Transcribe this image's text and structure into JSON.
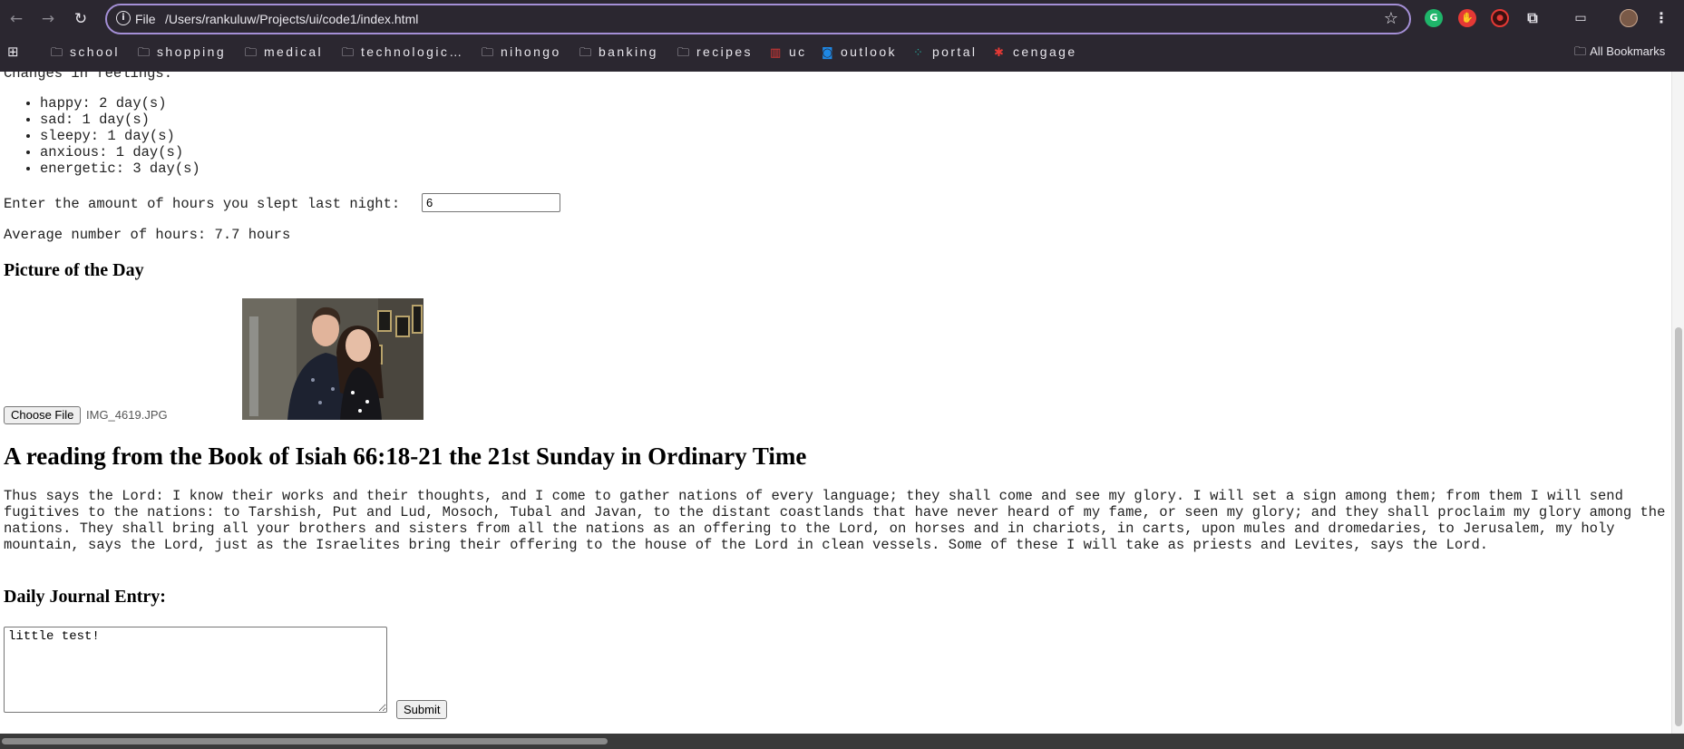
{
  "browser": {
    "scheme_label": "File",
    "url": "/Users/rankuluw/Projects/ui/code1/index.html",
    "bookmarks": [
      {
        "label": "school",
        "icon": "folder-icon"
      },
      {
        "label": "shopping",
        "icon": "folder-icon"
      },
      {
        "label": "medical",
        "icon": "folder-icon"
      },
      {
        "label": "technologic…",
        "icon": "folder-icon"
      },
      {
        "label": "nihongo",
        "icon": "folder-icon"
      },
      {
        "label": "banking",
        "icon": "folder-icon"
      },
      {
        "label": "recipes",
        "icon": "folder-icon"
      },
      {
        "label": "uc",
        "icon": "uc-logo-icon"
      },
      {
        "label": "outlook",
        "icon": "outlook-icon"
      },
      {
        "label": "portal",
        "icon": "portal-icon"
      },
      {
        "label": "cengage",
        "icon": "cengage-icon"
      }
    ],
    "all_bookmarks_label": "All Bookmarks"
  },
  "feelings": {
    "heading": "Changes in feelings:",
    "items": [
      "happy: 2 day(s)",
      "sad: 1 day(s)",
      "sleepy: 1 day(s)",
      "anxious: 1 day(s)",
      "energetic: 3 day(s)"
    ]
  },
  "sleep": {
    "prompt": "Enter the amount of hours you slept last night:",
    "value": "6",
    "average_text": "Average number of hours: 7.7 hours"
  },
  "picture": {
    "heading": "Picture of the Day",
    "choose_label": "Choose File",
    "file_name": "IMG_4619.JPG"
  },
  "reading": {
    "title": "A reading from the Book of Isiah 66:18-21 the 21st Sunday in Ordinary Time",
    "text": "Thus says the Lord: I know their works and their thoughts, and I come to gather nations of every language; they shall come and see my glory. I will set a sign among them; from them I will send fugitives to the nations: to Tarshish, Put and Lud, Mosoch, Tubal and Javan, to the distant coastlands that have never heard of my fame, or seen my glory; and they shall proclaim my glory among the nations. They shall bring all your brothers and sisters from all the nations as an offering to the Lord, on horses and in chariots, in carts, upon mules and dromedaries, to Jerusalem, my holy mountain, says the Lord, just as the Israelites bring their offering to the house of the Lord in clean vessels. Some of these I will take as priests and Levites, says the Lord."
  },
  "journal": {
    "heading": "Daily Journal Entry:",
    "value": "little test!",
    "submit_label": "Submit"
  }
}
